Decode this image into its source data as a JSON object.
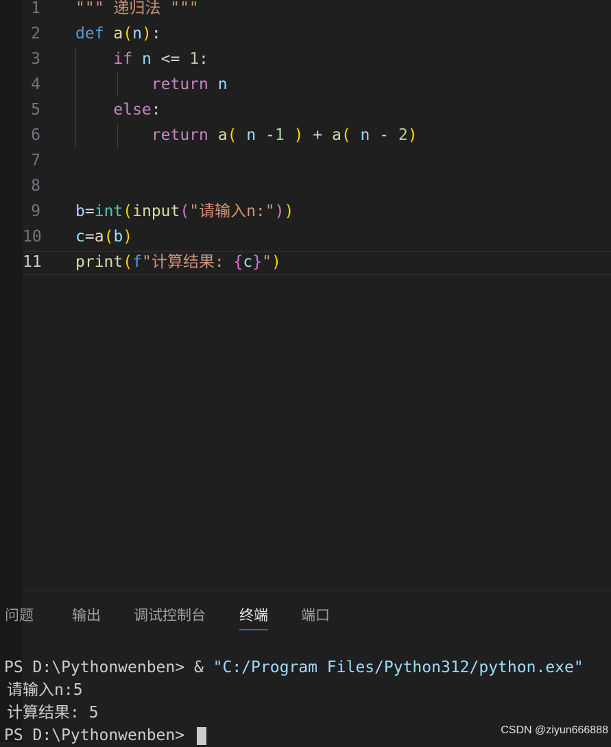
{
  "editor": {
    "lines": [
      {
        "num": "1",
        "parts": [
          {
            "t": "\"\"\" 递归法 \"\"\"",
            "c": "k-str"
          }
        ]
      },
      {
        "num": "2",
        "parts": [
          {
            "t": "def ",
            "c": "k-def"
          },
          {
            "t": "a",
            "c": "k-fn"
          },
          {
            "t": "(",
            "c": "k-p1"
          },
          {
            "t": "n",
            "c": "k-var"
          },
          {
            "t": ")",
            "c": "k-p1"
          },
          {
            "t": ":",
            "c": "k-op"
          }
        ]
      },
      {
        "num": "3",
        "parts": [
          {
            "t": "    if ",
            "c": "k-ctl"
          },
          {
            "t": "n",
            "c": "k-var"
          },
          {
            "t": " <= ",
            "c": "k-op"
          },
          {
            "t": "1",
            "c": "k-num"
          },
          {
            "t": ":",
            "c": "k-op"
          }
        ]
      },
      {
        "num": "4",
        "parts": [
          {
            "t": "        return ",
            "c": "k-ctl"
          },
          {
            "t": "n",
            "c": "k-var"
          }
        ]
      },
      {
        "num": "5",
        "parts": [
          {
            "t": "    else",
            "c": "k-ctl"
          },
          {
            "t": ":",
            "c": "k-op"
          }
        ]
      },
      {
        "num": "6",
        "parts": [
          {
            "t": "        return ",
            "c": "k-ctl"
          },
          {
            "t": "a",
            "c": "k-fn"
          },
          {
            "t": "(",
            "c": "k-p1"
          },
          {
            "t": " n ",
            "c": "k-var"
          },
          {
            "t": "-",
            "c": "k-op"
          },
          {
            "t": "1",
            "c": "k-num"
          },
          {
            "t": " )",
            "c": "k-p1"
          },
          {
            "t": " + ",
            "c": "k-op"
          },
          {
            "t": "a",
            "c": "k-fn"
          },
          {
            "t": "(",
            "c": "k-p1"
          },
          {
            "t": " n ",
            "c": "k-var"
          },
          {
            "t": "- ",
            "c": "k-op"
          },
          {
            "t": "2",
            "c": "k-num"
          },
          {
            "t": ")",
            "c": "k-p1"
          }
        ]
      },
      {
        "num": "7",
        "parts": []
      },
      {
        "num": "8",
        "parts": []
      },
      {
        "num": "9",
        "parts": [
          {
            "t": "b",
            "c": "k-var"
          },
          {
            "t": "=",
            "c": "k-op"
          },
          {
            "t": "int",
            "c": "k-cls"
          },
          {
            "t": "(",
            "c": "k-p1"
          },
          {
            "t": "input",
            "c": "k-fn"
          },
          {
            "t": "(",
            "c": "k-p2"
          },
          {
            "t": "\"请输入n:\"",
            "c": "k-str"
          },
          {
            "t": ")",
            "c": "k-p2"
          },
          {
            "t": ")",
            "c": "k-p1"
          }
        ]
      },
      {
        "num": "10",
        "parts": [
          {
            "t": "c",
            "c": "k-var"
          },
          {
            "t": "=",
            "c": "k-op"
          },
          {
            "t": "a",
            "c": "k-fn"
          },
          {
            "t": "(",
            "c": "k-p1"
          },
          {
            "t": "b",
            "c": "k-var"
          },
          {
            "t": ")",
            "c": "k-p1"
          }
        ]
      },
      {
        "num": "11",
        "active": true,
        "parts": [
          {
            "t": "print",
            "c": "k-fn"
          },
          {
            "t": "(",
            "c": "k-p1"
          },
          {
            "t": "f",
            "c": "k-def"
          },
          {
            "t": "\"计算结果: ",
            "c": "k-str"
          },
          {
            "t": "{",
            "c": "k-p2"
          },
          {
            "t": "c",
            "c": "k-var"
          },
          {
            "t": "}",
            "c": "k-p2"
          },
          {
            "t": "\"",
            "c": "k-str"
          },
          {
            "t": ")",
            "c": "k-p1"
          }
        ]
      }
    ]
  },
  "panel": {
    "tabs": [
      {
        "label": "问题",
        "name": "tab-problems"
      },
      {
        "label": "输出",
        "name": "tab-output"
      },
      {
        "label": "调试控制台",
        "name": "tab-debug-console"
      },
      {
        "label": "终端",
        "name": "tab-terminal",
        "active": true
      },
      {
        "label": "端口",
        "name": "tab-ports"
      }
    ],
    "terminal": {
      "line1_prompt": "PS D:\\Pythonwenben> & ",
      "line1_cmd": "\"C:/Program Files/Python312/python.exe\"",
      "line2": "请输入n:5",
      "line3": "计算结果: 5",
      "line4_prompt": "PS D:\\Pythonwenben> "
    }
  },
  "watermark": "CSDN @ziyun666888"
}
